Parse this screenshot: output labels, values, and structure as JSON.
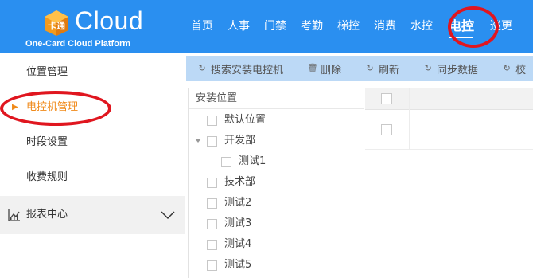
{
  "header": {
    "logo_word": "Cloud",
    "logo_sub": "One-Card Cloud Platform",
    "logo_mark_text": "卡通",
    "nav": [
      "首页",
      "人事",
      "门禁",
      "考勤",
      "梯控",
      "消费",
      "水控",
      "电控",
      "巡更"
    ],
    "active_nav": "电控"
  },
  "sidebar": {
    "items": [
      "位置管理",
      "电控机管理",
      "时段设置",
      "收费规则"
    ],
    "active_item": "电控机管理",
    "group_label": "报表中心"
  },
  "toolbar": {
    "buttons": [
      {
        "icon": "refresh-icon",
        "label": "搜索安装电控机"
      },
      {
        "icon": "trash-icon",
        "label": "删除"
      },
      {
        "icon": "refresh-icon",
        "label": "刷新"
      },
      {
        "icon": "refresh-icon",
        "label": "同步数据"
      },
      {
        "icon": "refresh-icon",
        "label": "校"
      }
    ]
  },
  "tree": {
    "header": "安装位置",
    "nodes": [
      {
        "label": "默认位置",
        "level": 0
      },
      {
        "label": "开发部",
        "level": 0,
        "expanded": true
      },
      {
        "label": "测试1",
        "level": 1
      },
      {
        "label": "技术部",
        "level": 0
      },
      {
        "label": "测试2",
        "level": 0
      },
      {
        "label": "测试3",
        "level": 0
      },
      {
        "label": "测试4",
        "level": 0
      },
      {
        "label": "测试5",
        "level": 0
      }
    ]
  },
  "colors": {
    "header_bg": "#2a8ff0",
    "accent_orange": "#f08a1a",
    "toolbar_bg": "#bcd9f6",
    "annotation_red": "#e0161f"
  }
}
